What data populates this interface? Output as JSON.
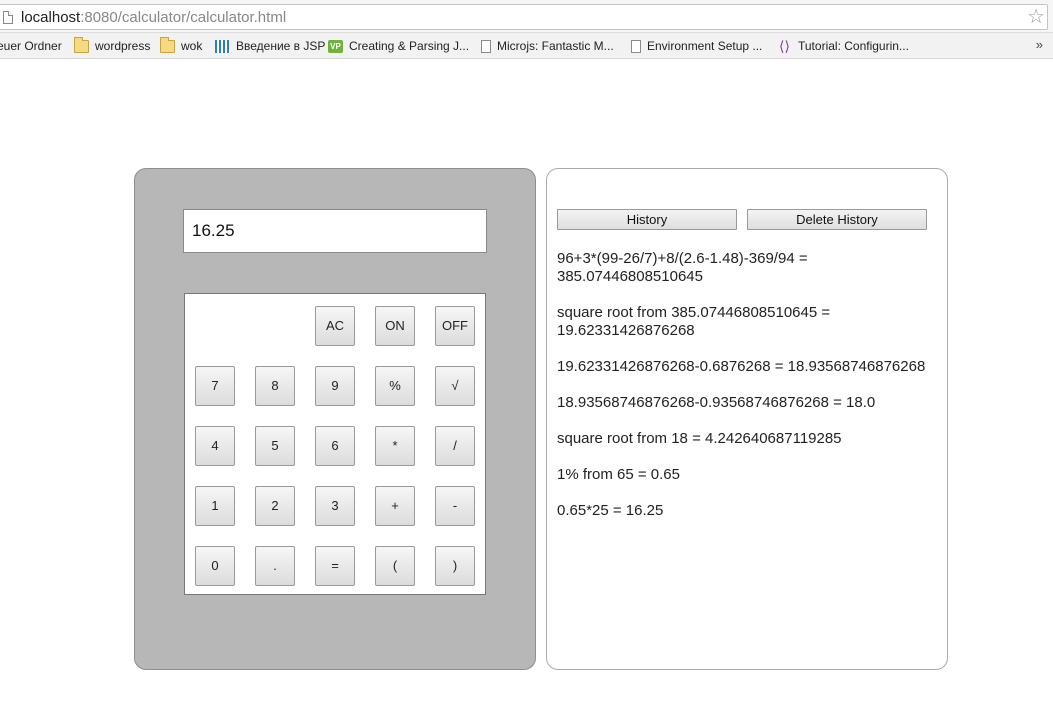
{
  "browser": {
    "url_host": "localhost",
    "url_rest": ":8080/calculator/calculator.html",
    "bookmarks": [
      {
        "label": "euer Ordner",
        "icon": "folder-icon"
      },
      {
        "label": "wordpress",
        "icon": "folder-icon"
      },
      {
        "label": "wok",
        "icon": "folder-icon"
      },
      {
        "label": "Введение в JSP",
        "icon": "jsp-icon"
      },
      {
        "label": "Creating & Parsing J...",
        "icon": "vp-icon"
      },
      {
        "label": "Microjs: Fantastic M...",
        "icon": "page-icon"
      },
      {
        "label": "Environment Setup ...",
        "icon": "page-icon"
      },
      {
        "label": "Tutorial: Configurin...",
        "icon": "visual-studio-icon"
      }
    ],
    "more_label": "»",
    "vp_text": "VP",
    "star_glyph": "☆"
  },
  "calculator": {
    "display_value": "16.25",
    "keys": {
      "ac": "AC",
      "on": "ON",
      "off": "OFF",
      "k7": "7",
      "k8": "8",
      "k9": "9",
      "percent": "%",
      "sqrt": "√",
      "k4": "4",
      "k5": "5",
      "k6": "6",
      "multiply": "*",
      "divide": "/",
      "k1": "1",
      "k2": "2",
      "k3": "3",
      "plus": "+",
      "minus": "-",
      "k0": "0",
      "dot": ".",
      "equals": "=",
      "lparen": "(",
      "rparen": ")"
    }
  },
  "history": {
    "history_label": "History",
    "delete_label": "Delete History",
    "entries": [
      "96+3*(99-26/7)+8/(2.6-1.48)-369/94 = 385.07446808510645",
      "square root from 385.07446808510645 = 19.62331426876268",
      "19.62331426876268-0.6876268 = 18.93568746876268",
      "18.93568746876268-0.93568746876268 = 18.0",
      "square root from 18 = 4.242640687119285",
      "1% from 65 = 0.65",
      "0.65*25 = 16.25"
    ]
  }
}
